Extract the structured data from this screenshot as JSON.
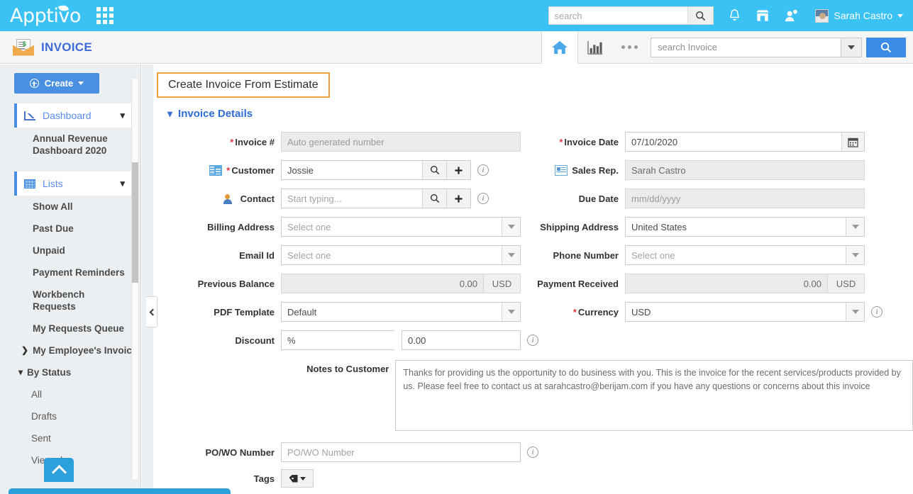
{
  "topbar": {
    "brand": "Apptivo",
    "apps_icon": "apps-grid-icon",
    "search_placeholder": "search",
    "search_value": "",
    "search_icon": "search-icon",
    "notification_icon": "bell-icon",
    "store_icon": "store-icon",
    "users_icon": "people-icon",
    "user_name": "Sarah Castro",
    "avatar_icon": "avatar-icon",
    "user_caret": "chevron-down-icon"
  },
  "modulebar": {
    "module_icon": "invoice-mail-icon",
    "module_name": "INVOICE",
    "home_icon": "home-icon",
    "reports_icon": "bar-chart-icon",
    "more_icon": "ellipsis-icon",
    "search_placeholder": "search Invoice",
    "search_value": "",
    "dropdown_icon": "chevron-down-icon",
    "search_button_icon": "search-icon"
  },
  "sidebar": {
    "create_label": "Create",
    "create_icon": "plus-circle-icon",
    "create_caret": "caret-down-icon",
    "sections": [
      {
        "label": "Dashboard",
        "icon": "line-chart-icon",
        "caret": "chevron-down-icon",
        "items": [
          "Annual Revenue Dashboard 2020"
        ]
      },
      {
        "label": "Lists",
        "icon": "grid-table-icon",
        "caret": "chevron-down-icon",
        "items": [
          "Show All",
          "Past Due",
          "Unpaid",
          "Payment Reminders",
          "Workbench Requests",
          "My Requests Queue"
        ]
      }
    ],
    "groups": [
      {
        "label": "My Employee's Invoic",
        "arrow": "chevron-right-icon",
        "expanded": false,
        "items": []
      },
      {
        "label": "By Status",
        "arrow": "chevron-down-icon",
        "expanded": true,
        "items": [
          "All",
          "Drafts",
          "Sent",
          "Viewed"
        ]
      }
    ],
    "scroll_top_icon": "chevron-up-icon",
    "collapse_icon": "chevron-left-icon"
  },
  "content": {
    "page_title": "Create Invoice From Estimate",
    "page_title_border_color": "#e8a33d",
    "section_title": "Invoice Details",
    "section_caret": "chevron-down-icon",
    "fields": {
      "invoice_number": {
        "label": "Invoice #",
        "required": true,
        "placeholder": "Auto generated number",
        "value": "",
        "readonly": true
      },
      "customer": {
        "label": "Customer",
        "required": true,
        "icon": "building-icon",
        "value": "Jossie",
        "placeholder": "",
        "search_icon": "search-icon",
        "add_icon": "plus-icon",
        "info_icon": "info-icon"
      },
      "contact": {
        "label": "Contact",
        "required": false,
        "icon": "contact-person-icon",
        "value": "",
        "placeholder": "Start typing...",
        "search_icon": "search-icon",
        "add_icon": "plus-icon",
        "info_icon": "info-icon"
      },
      "billing_address": {
        "label": "Billing Address",
        "value": "",
        "placeholder": "Select one",
        "dropdown_icon": "caret-down-icon"
      },
      "email_id": {
        "label": "Email Id",
        "value": "",
        "placeholder": "Select one",
        "dropdown_icon": "caret-down-icon"
      },
      "previous_balance": {
        "label": "Previous Balance",
        "value": "0.00",
        "unit": "USD",
        "readonly": true
      },
      "pdf_template": {
        "label": "PDF Template",
        "value": "Default",
        "dropdown_icon": "caret-down-icon"
      },
      "discount": {
        "label": "Discount",
        "type_value": "%",
        "amount_value": "0.00",
        "dropdown_icon": "caret-down-icon",
        "info_icon": "info-icon"
      },
      "invoice_date": {
        "label": "Invoice Date",
        "required": true,
        "value": "07/10/2020",
        "calendar_icon": "calendar-icon"
      },
      "sales_rep": {
        "label": "Sales Rep.",
        "icon": "id-card-icon",
        "value": "Sarah Castro",
        "readonly": true
      },
      "due_date": {
        "label": "Due Date",
        "value": "",
        "placeholder": "mm/dd/yyyy",
        "readonly": true
      },
      "shipping_address": {
        "label": "Shipping Address",
        "value": "United States",
        "dropdown_icon": "caret-down-icon"
      },
      "phone_number": {
        "label": "Phone Number",
        "value": "",
        "placeholder": "Select one",
        "dropdown_icon": "caret-down-icon"
      },
      "payment_received": {
        "label": "Payment Received",
        "value": "0.00",
        "unit": "USD",
        "readonly": true
      },
      "currency": {
        "label": "Currency",
        "required": true,
        "value": "USD",
        "dropdown_icon": "caret-down-icon",
        "info_icon": "info-icon"
      },
      "notes_to_customer": {
        "label": "Notes to Customer",
        "value": "Thanks for providing us the opportunity to do business with you. This is the invoice for the recent services/products provided by us. Please feel free to contact us at sarahcastro@berijam.com if you have any questions or concerns about this invoice"
      },
      "po_wo_number": {
        "label": "PO/WO Number",
        "value": "",
        "placeholder": "PO/WO Number",
        "info_icon": "info-icon"
      },
      "tags": {
        "label": "Tags",
        "icon": "tag-icon",
        "caret": "caret-down-icon"
      }
    }
  },
  "colors": {
    "brand_blue": "#3bc2f5",
    "accent_blue": "#4a90e2",
    "title_border": "#e8a33d",
    "link_blue": "#2f6cd4",
    "required_red": "#e03b3b"
  }
}
